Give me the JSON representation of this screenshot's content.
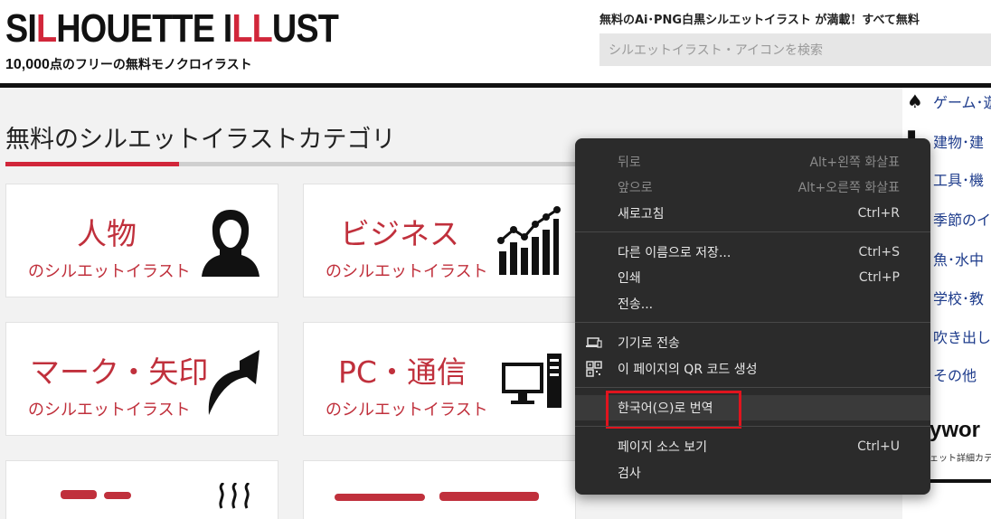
{
  "header": {
    "logo_a": "SI",
    "logo_b": "L",
    "logo_c": "HOUETTE I",
    "logo_d": "LL",
    "logo_e": "UST",
    "logo_sub_num": "10,000",
    "logo_sub_text": "点のフリーの無料モノクロイラスト",
    "tagline": "無料のAi･PNG白黒シルエットイラスト が満載！すべて無料",
    "search_placeholder": "シルエットイラスト・アイコンを検索"
  },
  "sidebar": {
    "items": [
      {
        "label": "ゲーム･遊",
        "icon": "spade-icon"
      },
      {
        "label": "建物･建",
        "icon": "building-icon"
      },
      {
        "label": "工具･機",
        "icon": ""
      },
      {
        "label": "季節のイ",
        "icon": ""
      },
      {
        "label": "魚･水中",
        "icon": ""
      },
      {
        "label": "学校･教",
        "icon": ""
      },
      {
        "label": "吹き出し",
        "icon": ""
      },
      {
        "label": "その他",
        "icon": ""
      }
    ],
    "keyword_title": "ywor",
    "keyword_sub": "ェット詳細カテ"
  },
  "main": {
    "section_title": "無料のシルエットイラストカテゴリ",
    "cards": [
      {
        "title": "人物",
        "sub": "のシルエットイラスト",
        "icon": "person-icon"
      },
      {
        "title": "ビジネス",
        "sub": "のシルエットイラスト",
        "icon": "bar-chart-icon"
      },
      {
        "title": "マーク・矢印",
        "sub": "のシルエットイラスト",
        "icon": "arrow-icon"
      },
      {
        "title": "PC・通信",
        "sub": "のシルエットイラスト",
        "icon": "computer-icon"
      }
    ]
  },
  "context_menu": {
    "items": [
      {
        "label": "뒤로",
        "shortcut": "Alt+왼쪽 화살표",
        "disabled": true
      },
      {
        "label": "앞으로",
        "shortcut": "Alt+오른쪽 화살표",
        "disabled": true
      },
      {
        "label": "새로고침",
        "shortcut": "Ctrl+R",
        "disabled": false
      },
      {
        "label": "다른 이름으로 저장...",
        "shortcut": "Ctrl+S",
        "disabled": false
      },
      {
        "label": "인쇄",
        "shortcut": "Ctrl+P",
        "disabled": false
      },
      {
        "label": "전송...",
        "shortcut": "",
        "disabled": false
      },
      {
        "label": "기기로 전송",
        "shortcut": "",
        "icon": "device-icon"
      },
      {
        "label": "이 페이지의 QR 코드 생성",
        "shortcut": "",
        "icon": "qr-code-icon"
      },
      {
        "label": "한국어(으)로 번역",
        "shortcut": "",
        "highlight": true
      },
      {
        "label": "페이지 소스 보기",
        "shortcut": "Ctrl+U"
      },
      {
        "label": "검사",
        "shortcut": ""
      }
    ]
  }
}
